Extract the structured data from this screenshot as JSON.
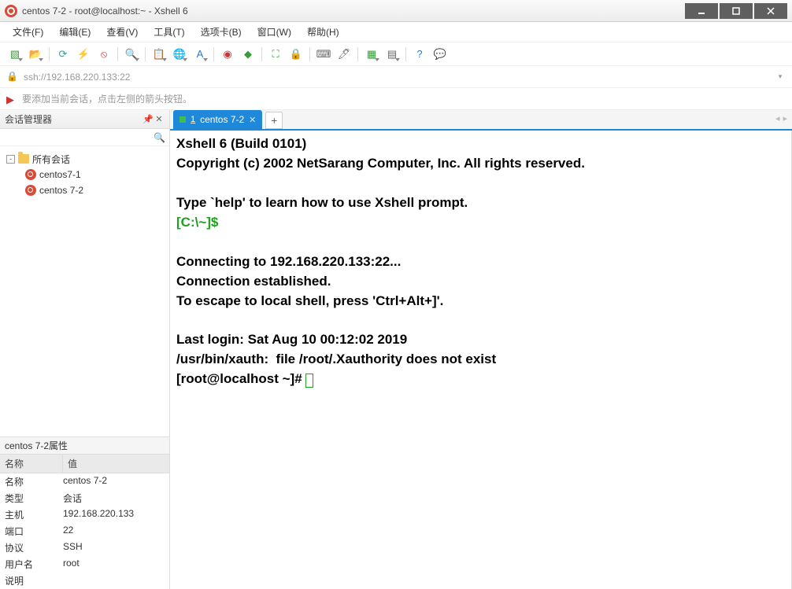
{
  "window": {
    "title": "centos 7-2 - root@localhost:~ - Xshell 6"
  },
  "menu": {
    "items": [
      "文件(F)",
      "编辑(E)",
      "查看(V)",
      "工具(T)",
      "选项卡(B)",
      "窗口(W)",
      "帮助(H)"
    ]
  },
  "address": {
    "url": "ssh://192.168.220.133:22"
  },
  "hint": {
    "text": "要添加当前会话，点击左侧的箭头按钮。"
  },
  "sidebar": {
    "title": "会话管理器",
    "root": "所有会话",
    "sessions": [
      "centos7-1",
      "centos 7-2"
    ]
  },
  "props": {
    "title": "centos 7-2属性",
    "head_key": "名称",
    "head_val": "值",
    "rows": [
      {
        "k": "名称",
        "v": "centos 7-2"
      },
      {
        "k": "类型",
        "v": "会话"
      },
      {
        "k": "主机",
        "v": "192.168.220.133"
      },
      {
        "k": "端口",
        "v": "22"
      },
      {
        "k": "协议",
        "v": "SSH"
      },
      {
        "k": "用户名",
        "v": "root"
      },
      {
        "k": "说明",
        "v": ""
      }
    ]
  },
  "tab": {
    "num": "1",
    "label": "centos 7-2"
  },
  "terminal": {
    "line1": "Xshell 6 (Build 0101)",
    "line2": "Copyright (c) 2002 NetSarang Computer, Inc. All rights reserved.",
    "line3": "",
    "line4": "Type `help' to learn how to use Xshell prompt.",
    "prompt1": "[C:\\~]$",
    "line5": "",
    "line6": "Connecting to 192.168.220.133:22...",
    "line7": "Connection established.",
    "line8": "To escape to local shell, press 'Ctrl+Alt+]'.",
    "line9": "",
    "line10": "Last login: Sat Aug 10 00:12:02 2019",
    "line11": "/usr/bin/xauth:  file /root/.Xauthority does not exist",
    "prompt2": "[root@localhost ~]# "
  }
}
